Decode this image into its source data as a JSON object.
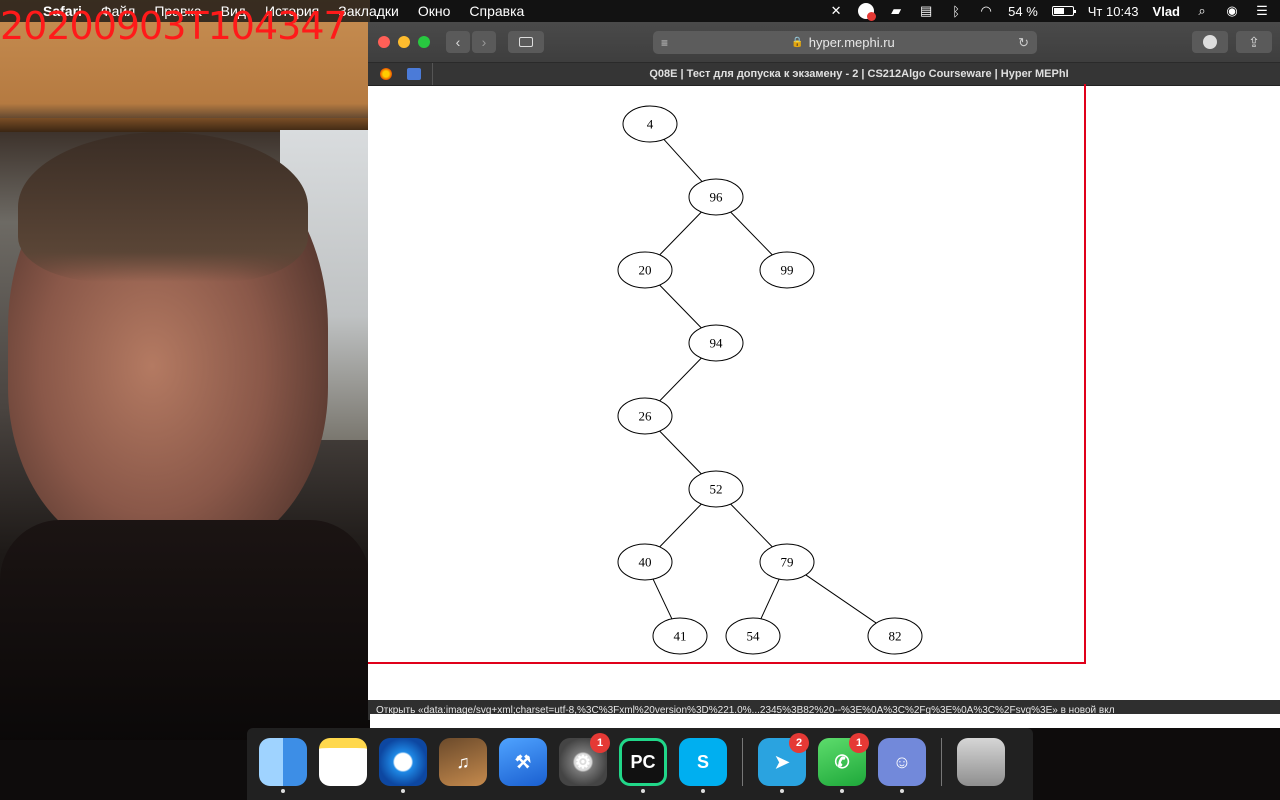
{
  "overlay": {
    "timestamp": "20200903T104347"
  },
  "menubar": {
    "app_name": "Safari",
    "menus": [
      "Файл",
      "Правка",
      "Вид",
      "История",
      "Закладки",
      "Окно",
      "Справка"
    ],
    "battery_percent": "54 %",
    "clock": "Чт 10:43",
    "user": "Vlad"
  },
  "browser": {
    "host": "hyper.mephi.ru",
    "tab_title": "Q08E | Тест для допуска к экзамену - 2 | CS212Algo Courseware | Hyper MEPhI",
    "status_text": "Открыть «data:image/svg+xml;charset=utf-8,%3C%3Fxml%20version%3D%221.0%...2345%3B82%20--%3E%0A%3C%2Fg%3E%0A%3C%2Fsvg%3E» в новой вкл"
  },
  "tree": {
    "nodes": [
      "4",
      "96",
      "20",
      "99",
      "94",
      "26",
      "52",
      "40",
      "79",
      "41",
      "54",
      "82"
    ],
    "edges": [
      [
        "4",
        "96"
      ],
      [
        "96",
        "20"
      ],
      [
        "96",
        "99"
      ],
      [
        "20",
        "94"
      ],
      [
        "94",
        "26"
      ],
      [
        "26",
        "52"
      ],
      [
        "52",
        "40"
      ],
      [
        "52",
        "79"
      ],
      [
        "40",
        "41"
      ],
      [
        "79",
        "54"
      ],
      [
        "79",
        "82"
      ]
    ]
  },
  "dock": {
    "apps": [
      {
        "name": "Finder",
        "glyph": "",
        "running": true
      },
      {
        "name": "Notes",
        "glyph": "",
        "running": false
      },
      {
        "name": "Safari",
        "glyph": "",
        "running": true
      },
      {
        "name": "GarageBand",
        "glyph": "♫",
        "running": false
      },
      {
        "name": "Xcode",
        "glyph": "⚒",
        "running": false
      },
      {
        "name": "System Preferences",
        "glyph": "⚙",
        "running": false,
        "badge": "1"
      },
      {
        "name": "PyCharm",
        "glyph": "PC",
        "running": true
      },
      {
        "name": "Skype",
        "glyph": "S",
        "running": true
      },
      {
        "name": "Telegram",
        "glyph": "➤",
        "running": true,
        "badge": "2"
      },
      {
        "name": "FaceTime",
        "glyph": "✆",
        "running": true,
        "badge": "1"
      },
      {
        "name": "Discord",
        "glyph": "☺",
        "running": true
      },
      {
        "name": "Trash",
        "glyph": "",
        "running": false
      }
    ]
  }
}
